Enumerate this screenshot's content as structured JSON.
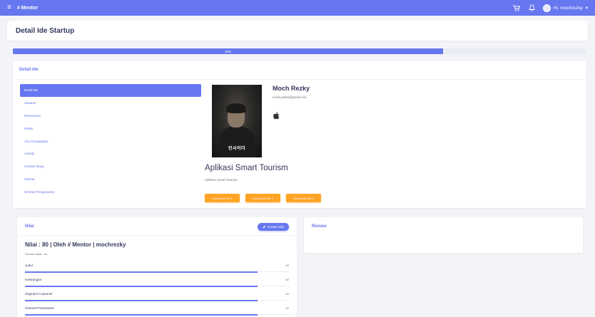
{
  "topbar": {
    "menu_glyph": "≡",
    "brand": "# Mentor",
    "user_greeting": "Hi, mochrezky",
    "icons": [
      "hamburger-icon",
      "cart-icon",
      "bell-icon",
      "avatar"
    ]
  },
  "page": {
    "title": "Detail Ide Startup"
  },
  "progress": {
    "label": "75%",
    "value": 75
  },
  "detail": {
    "section_title": "Detail Ide",
    "nav": [
      {
        "label": "Detail Ide",
        "active": true
      },
      {
        "label": "Sasaran"
      },
      {
        "label": "Pemasaran"
      },
      {
        "label": "Relasi"
      },
      {
        "label": "Alur Pendapatan"
      },
      {
        "label": "Activity"
      },
      {
        "label": "Sumber Daya"
      },
      {
        "label": "Partner"
      },
      {
        "label": "Struktur Pengeluaran"
      }
    ],
    "poster_text": "인사이더",
    "profile": {
      "name": "Moch Rezky",
      "email": "moch.patra@gmail.com"
    },
    "idea": {
      "title": "Aplikasi Smart Tourism",
      "subtitle": "Aplikasi Smart Tourism"
    },
    "buttons": [
      "Download File 1",
      "Download File 2",
      "Download File 3"
    ]
  },
  "nilai": {
    "section_title": "Nilai",
    "create_label": "Create Nilai",
    "heading": "Nilai : 80 | Oleh # Mentor | mochrezky",
    "sub": "Sesuaui Nilai : ok",
    "scores": [
      {
        "label": "Judul",
        "value": 80
      },
      {
        "label": "Keterangan",
        "value": 80
      },
      {
        "label": "Segment Customer",
        "value": 80
      },
      {
        "label": "Channel Pemasaran",
        "value": 80
      }
    ]
  },
  "review": {
    "section_title": "Review"
  },
  "colors": {
    "primary": "#6777ef",
    "warning": "#ffa426",
    "background": "#f3f4f8"
  }
}
